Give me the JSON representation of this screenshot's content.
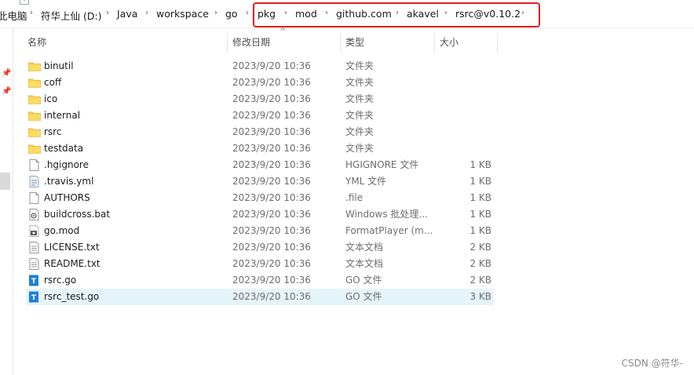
{
  "breadcrumb": [
    "此电脑",
    "符华上仙 (D:)",
    "Java",
    "workspace",
    "go",
    "pkg",
    "mod",
    "github.com",
    "akavel",
    "rsrc@v0.10.2"
  ],
  "columns": {
    "name": "名称",
    "date": "修改日期",
    "type": "类型",
    "size": "大小"
  },
  "files": [
    {
      "name": "binutil",
      "date": "2023/9/20 10:36",
      "type": "文件夹",
      "size": "",
      "icon": "folder-icon"
    },
    {
      "name": "coff",
      "date": "2023/9/20 10:36",
      "type": "文件夹",
      "size": "",
      "icon": "folder-icon"
    },
    {
      "name": "ico",
      "date": "2023/9/20 10:36",
      "type": "文件夹",
      "size": "",
      "icon": "folder-icon"
    },
    {
      "name": "internal",
      "date": "2023/9/20 10:36",
      "type": "文件夹",
      "size": "",
      "icon": "folder-icon"
    },
    {
      "name": "rsrc",
      "date": "2023/9/20 10:36",
      "type": "文件夹",
      "size": "",
      "icon": "folder-icon"
    },
    {
      "name": "testdata",
      "date": "2023/9/20 10:36",
      "type": "文件夹",
      "size": "",
      "icon": "folder-icon"
    },
    {
      "name": ".hgignore",
      "date": "2023/9/20 10:36",
      "type": "HGIGNORE 文件",
      "size": "1 KB",
      "icon": "file-icon"
    },
    {
      "name": ".travis.yml",
      "date": "2023/9/20 10:36",
      "type": "YML 文件",
      "size": "1 KB",
      "icon": "yml-file-icon"
    },
    {
      "name": "AUTHORS",
      "date": "2023/9/20 10:36",
      "type": ".file",
      "size": "1 KB",
      "icon": "file-icon"
    },
    {
      "name": "buildcross.bat",
      "date": "2023/9/20 10:36",
      "type": "Windows 批处理...",
      "size": "1 KB",
      "icon": "bat-file-icon"
    },
    {
      "name": "go.mod",
      "date": "2023/9/20 10:36",
      "type": "FormatPlayer (m...",
      "size": "1 KB",
      "icon": "media-file-icon"
    },
    {
      "name": "LICENSE.txt",
      "date": "2023/9/20 10:36",
      "type": "文本文档",
      "size": "2 KB",
      "icon": "text-file-icon"
    },
    {
      "name": "README.txt",
      "date": "2023/9/20 10:36",
      "type": "文本文档",
      "size": "2 KB",
      "icon": "text-file-icon"
    },
    {
      "name": "rsrc.go",
      "date": "2023/9/20 10:36",
      "type": "GO 文件",
      "size": "2 KB",
      "icon": "go-file-icon"
    },
    {
      "name": "rsrc_test.go",
      "date": "2023/9/20 10:36",
      "type": "GO 文件",
      "size": "3 KB",
      "icon": "go-file-icon"
    }
  ],
  "selected_index": 14,
  "watermark": "CSDN @符华-",
  "colors": {
    "folder": "#f8d44c",
    "selection": "#e5f3fb",
    "highlight_box": "#e02020",
    "go_icon": "#1e7fd4"
  }
}
